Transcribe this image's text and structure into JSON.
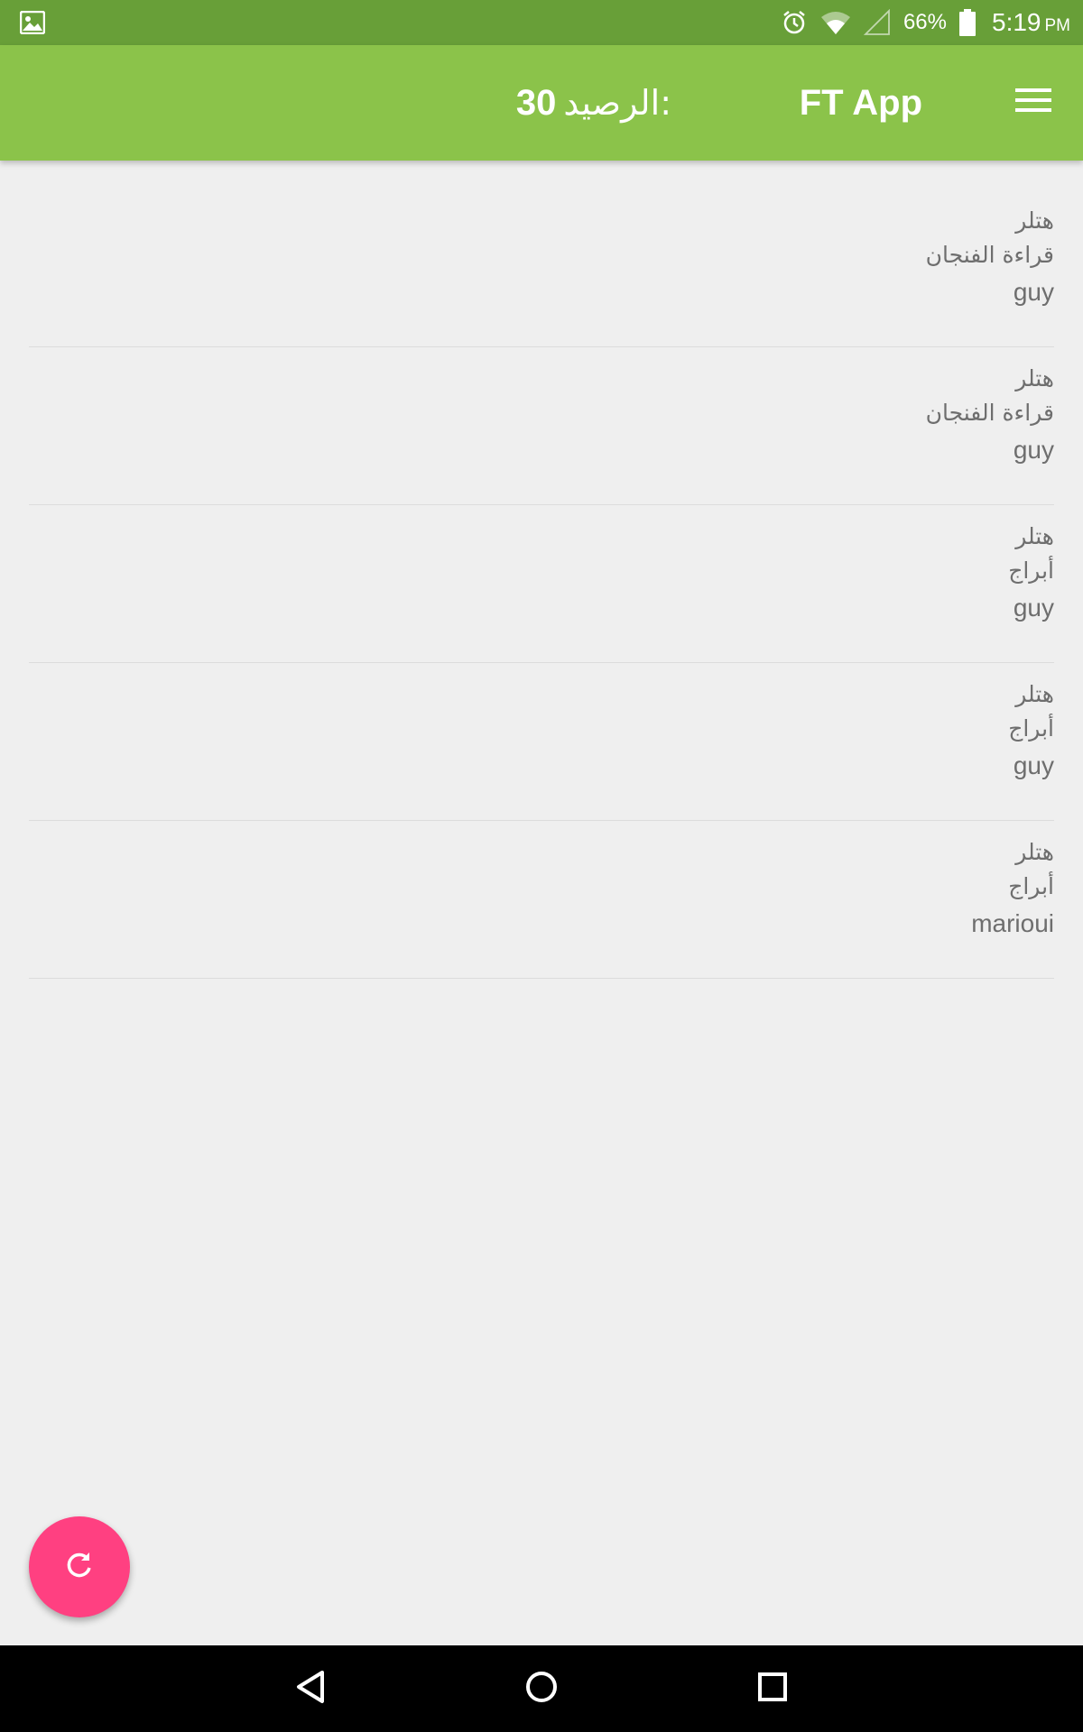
{
  "status_bar": {
    "notification_icon": "gallery-icon",
    "icons": [
      "alarm-icon",
      "wifi-icon",
      "signal-icon",
      "battery-icon"
    ],
    "battery_percent": "66%",
    "time": "5:19",
    "ampm": "PM"
  },
  "app_bar": {
    "menu_icon": "hamburger-menu-icon",
    "title": "FT App",
    "balance_label": "الرصيد:",
    "balance_value": "30"
  },
  "list": {
    "items": [
      {
        "line1": "هتلر",
        "line2": "قراءة الفنجان",
        "line3": "guy"
      },
      {
        "line1": "هتلر",
        "line2": "قراءة الفنجان",
        "line3": "guy"
      },
      {
        "line1": "هتلر",
        "line2": "أبراج",
        "line3": "guy"
      },
      {
        "line1": "هتلر",
        "line2": "أبراج",
        "line3": "guy"
      },
      {
        "line1": "هتلر",
        "line2": "أبراج",
        "line3": "marioui"
      }
    ]
  },
  "fab": {
    "icon": "refresh-icon",
    "color": "#ff4081"
  },
  "nav_bar": {
    "icons": [
      "back-icon",
      "home-icon",
      "recents-icon"
    ]
  },
  "colors": {
    "status_bar": "#689f38",
    "app_bar": "#8bc34a",
    "background": "#efefef",
    "text": "#6e6e6e"
  }
}
